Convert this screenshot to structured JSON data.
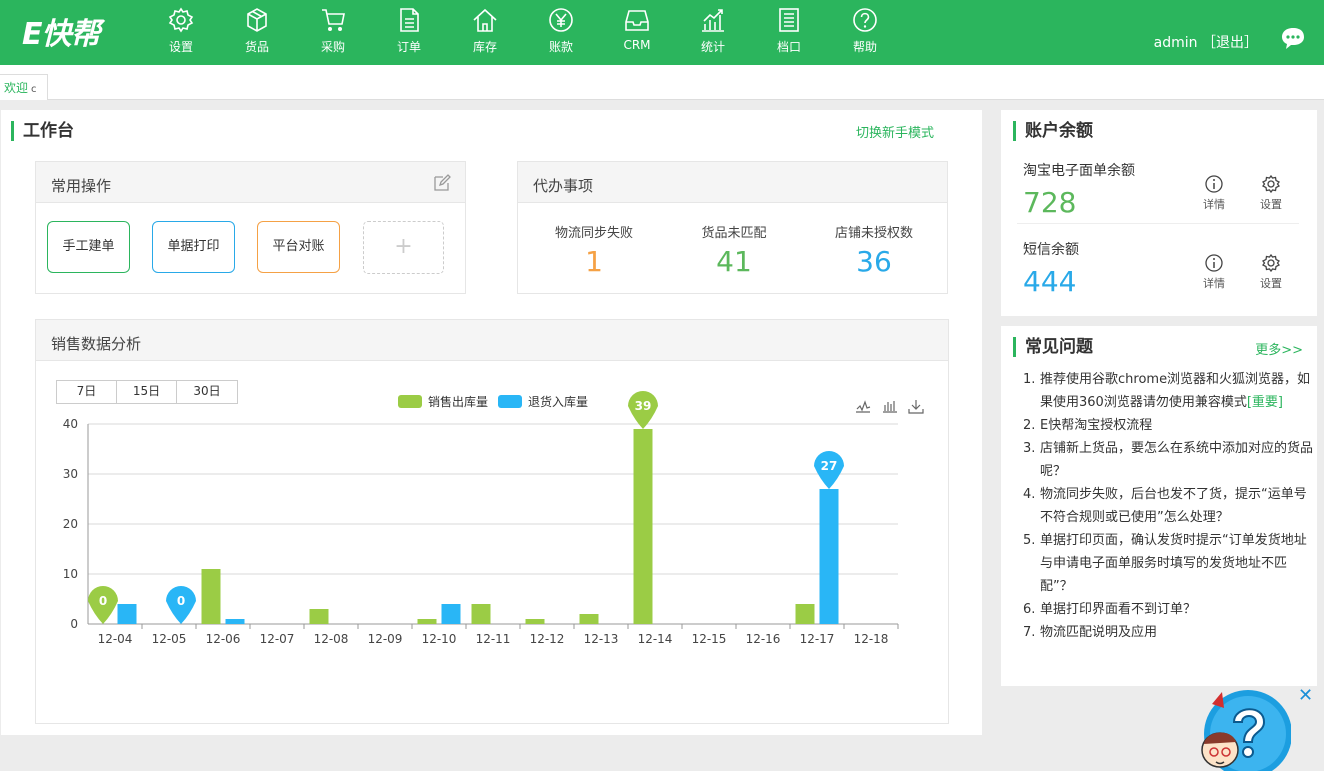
{
  "header": {
    "logo_prefix": "E",
    "logo_text": "快帮",
    "nav": [
      {
        "label": "设置",
        "icon": "gear-icon"
      },
      {
        "label": "货品",
        "icon": "box-icon"
      },
      {
        "label": "采购",
        "icon": "cart-icon"
      },
      {
        "label": "订单",
        "icon": "document-icon"
      },
      {
        "label": "库存",
        "icon": "home-icon"
      },
      {
        "label": "账款",
        "icon": "yen-icon"
      },
      {
        "label": "CRM",
        "icon": "tray-icon"
      },
      {
        "label": "统计",
        "icon": "chart-icon"
      },
      {
        "label": "档口",
        "icon": "list-icon"
      },
      {
        "label": "帮助",
        "icon": "question-icon"
      }
    ],
    "username": "admin",
    "logout_open": "［",
    "logout_label": "退出",
    "logout_close": "］"
  },
  "tabs": {
    "active_label": "欢迎",
    "refresh_glyph": "c"
  },
  "workbench": {
    "title": "工作台",
    "switch_mode": "切换新手模式",
    "common_ops": {
      "title": "常用操作",
      "buttons": [
        {
          "label": "手工建单",
          "color": "#2bb55d"
        },
        {
          "label": "单据打印",
          "color": "#29a9e8"
        },
        {
          "label": "平台对账",
          "color": "#f5a145"
        }
      ],
      "add_glyph": "+"
    },
    "todo": {
      "title": "代办事项",
      "items": [
        {
          "label": "物流同步失败",
          "value": "1",
          "color": "#f5a145"
        },
        {
          "label": "货品未匹配",
          "value": "41",
          "color": "#5cb85c"
        },
        {
          "label": "店铺未授权数",
          "value": "36",
          "color": "#29a9e8"
        }
      ]
    },
    "sales": {
      "title": "销售数据分析",
      "ranges": [
        "7日",
        "15日",
        "30日"
      ]
    }
  },
  "chart_data": {
    "type": "bar",
    "categories": [
      "12-04",
      "12-05",
      "12-06",
      "12-07",
      "12-08",
      "12-09",
      "12-10",
      "12-11",
      "12-12",
      "12-13",
      "12-14",
      "12-15",
      "12-16",
      "12-17",
      "12-18"
    ],
    "series": [
      {
        "name": "销售出库量",
        "color": "#9bcc45",
        "values": [
          0,
          0,
          11,
          0,
          3,
          0,
          1,
          4,
          1,
          2,
          39,
          0,
          0,
          4,
          0
        ]
      },
      {
        "name": "退货入库量",
        "color": "#29b6f6",
        "values": [
          4,
          0,
          1,
          0,
          0,
          0,
          4,
          0,
          0,
          0,
          0,
          0,
          0,
          27,
          0
        ]
      }
    ],
    "ylim": [
      0,
      40
    ],
    "yticks": [
      "0",
      "10",
      "20",
      "30",
      "40"
    ],
    "markers": [
      {
        "series": 0,
        "index": 0,
        "label": "0"
      },
      {
        "series": 1,
        "index": 1,
        "label": "0"
      },
      {
        "series": 0,
        "index": 10,
        "label": "39"
      },
      {
        "series": 1,
        "index": 13,
        "label": "27"
      }
    ],
    "grid": true,
    "legend": "top-center"
  },
  "balance": {
    "title": "账户余额",
    "rows": [
      {
        "label": "淘宝电子面单余额",
        "value": "728",
        "color": "#5cb85c",
        "detail": "详情",
        "settings": "设置"
      },
      {
        "label": "短信余额",
        "value": "444",
        "color": "#29a9e8",
        "detail": "详情",
        "settings": "设置"
      }
    ]
  },
  "faq": {
    "title": "常见问题",
    "more": "更多>>",
    "items": [
      {
        "num": "1.",
        "text": "推荐使用谷歌chrome浏览器和火狐浏览器，如果使用360浏览器请勿使用兼容模式",
        "tag": "[重要]"
      },
      {
        "num": "2.",
        "text": "E快帮淘宝授权流程"
      },
      {
        "num": "3.",
        "text": "店铺新上货品，要怎么在系统中添加对应的货品呢？"
      },
      {
        "num": "4.",
        "text": "物流同步失败，后台也发不了货，提示“运单号不符合规则或已使用”怎么处理？"
      },
      {
        "num": "5.",
        "text": "单据打印页面，确认发货时提示“订单发货地址与申请电子面单服务时填写的发货地址不匹配”？"
      },
      {
        "num": "6.",
        "text": "单据打印界面看不到订单？"
      },
      {
        "num": "7.",
        "text": "物流匹配说明及应用"
      }
    ]
  },
  "mascot": {
    "close_glyph": "✕"
  }
}
